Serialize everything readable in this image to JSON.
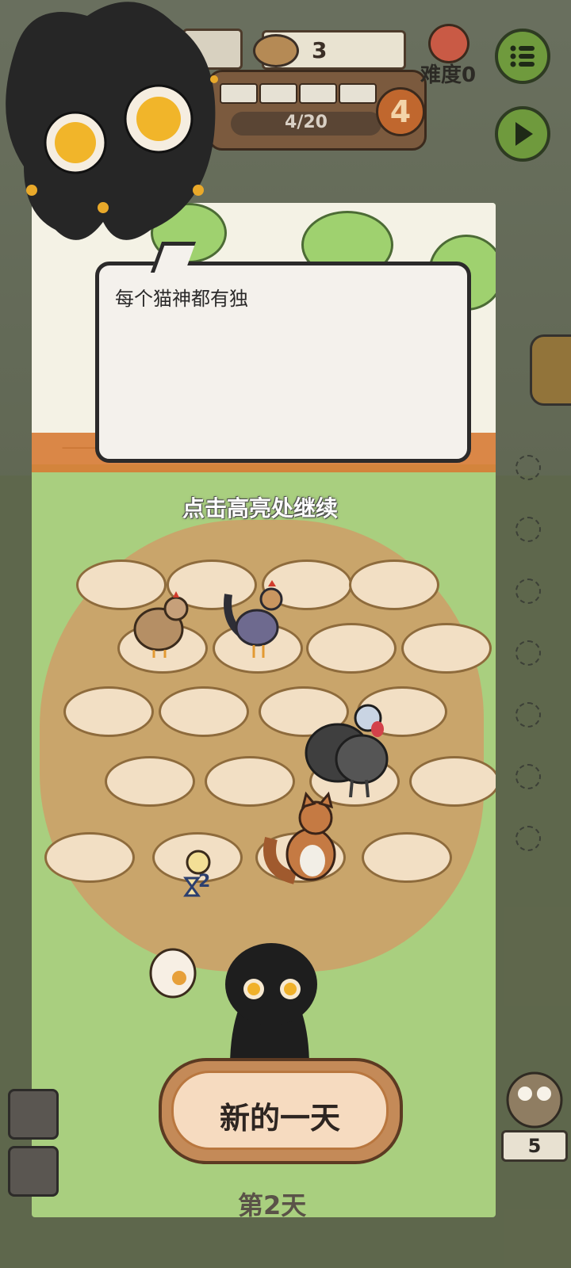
{
  "hud": {
    "food_count": "3",
    "progress_text": "4/20",
    "level_badge": "4",
    "difficulty_label": "难度0"
  },
  "dialog": {
    "text": "每个猫神都有独"
  },
  "hint": {
    "text": "点击高亮处继续"
  },
  "actions": {
    "new_day_label": "新的一天"
  },
  "status": {
    "day_label": "第2天",
    "hourglass_count": "2",
    "owl_count": "5"
  },
  "colors": {
    "accent_green": "#6f9a3d",
    "button_orange": "#c48a58",
    "dirt": "#c9a56b"
  },
  "icons": [
    "menu-icon",
    "play-icon",
    "bowl-icon",
    "difficulty-icon",
    "certificate-icon",
    "owl-icon",
    "penguin-icon",
    "hourglass-icon"
  ]
}
